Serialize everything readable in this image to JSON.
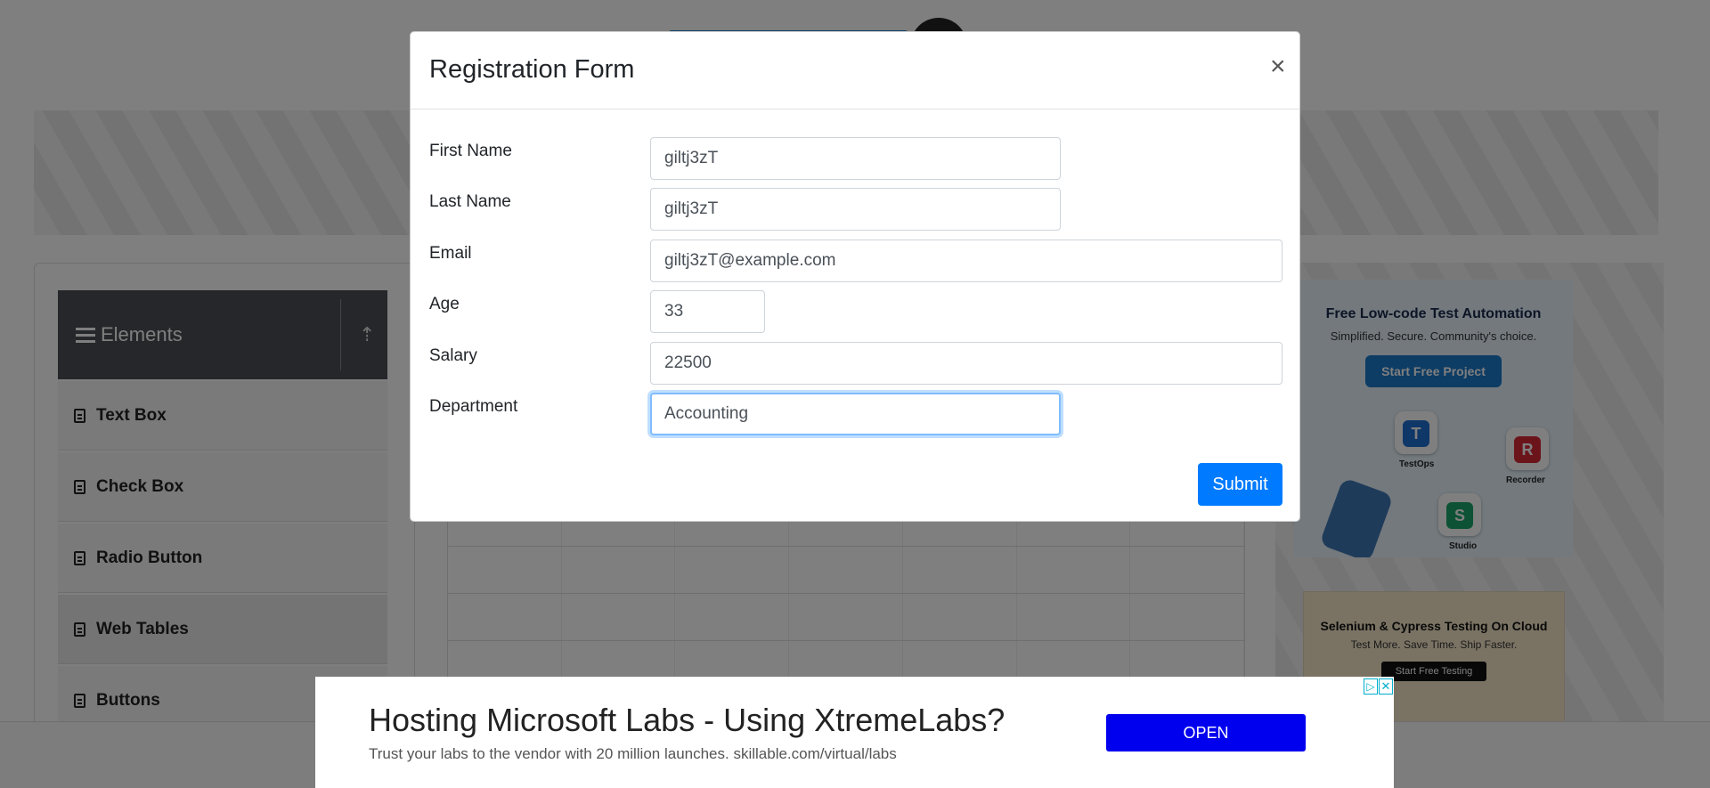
{
  "sidebar": {
    "title": "Elements",
    "items": [
      {
        "label": "Text Box"
      },
      {
        "label": "Check Box"
      },
      {
        "label": "Radio Button"
      },
      {
        "label": "Web Tables"
      },
      {
        "label": "Buttons"
      }
    ]
  },
  "modal": {
    "title": "Registration Form",
    "close_label": "×",
    "fields": [
      {
        "label": "First Name",
        "value": "giltj3zT"
      },
      {
        "label": "Last Name",
        "value": "giltj3zT"
      },
      {
        "label": "Email",
        "value": "giltj3zT@example.com"
      },
      {
        "label": "Age",
        "value": "33"
      },
      {
        "label": "Salary",
        "value": "22500"
      },
      {
        "label": "Department",
        "value": "Accounting"
      }
    ],
    "submit_label": "Submit"
  },
  "side_ad_1": {
    "headline": "Free Low-code Test Automation",
    "subline": "Simplified. Secure. Community's choice.",
    "button": "Start Free Project",
    "tiles": [
      {
        "letter": "T",
        "caption": "TestOps"
      },
      {
        "letter": "R",
        "caption": "Recorder"
      },
      {
        "letter": "S",
        "caption": "Studio"
      }
    ]
  },
  "side_ad_2": {
    "headline": "Selenium & Cypress Testing On Cloud",
    "subline": "Test More. Save Time. Ship Faster.",
    "button": "Start Free Testing"
  },
  "bottom_ad": {
    "headline": "Hosting Microsoft Labs - Using XtremeLabs?",
    "subline": "Trust your labs to the vendor with 20 million launches. skillable.com/virtual/labs",
    "button": "OPEN",
    "adchoice_glyph": "▷",
    "close_glyph": "✕"
  },
  "colors": {
    "primary": "#007bff",
    "ad_button": "#0000ee",
    "sidebar_header": "#4a4f55"
  }
}
